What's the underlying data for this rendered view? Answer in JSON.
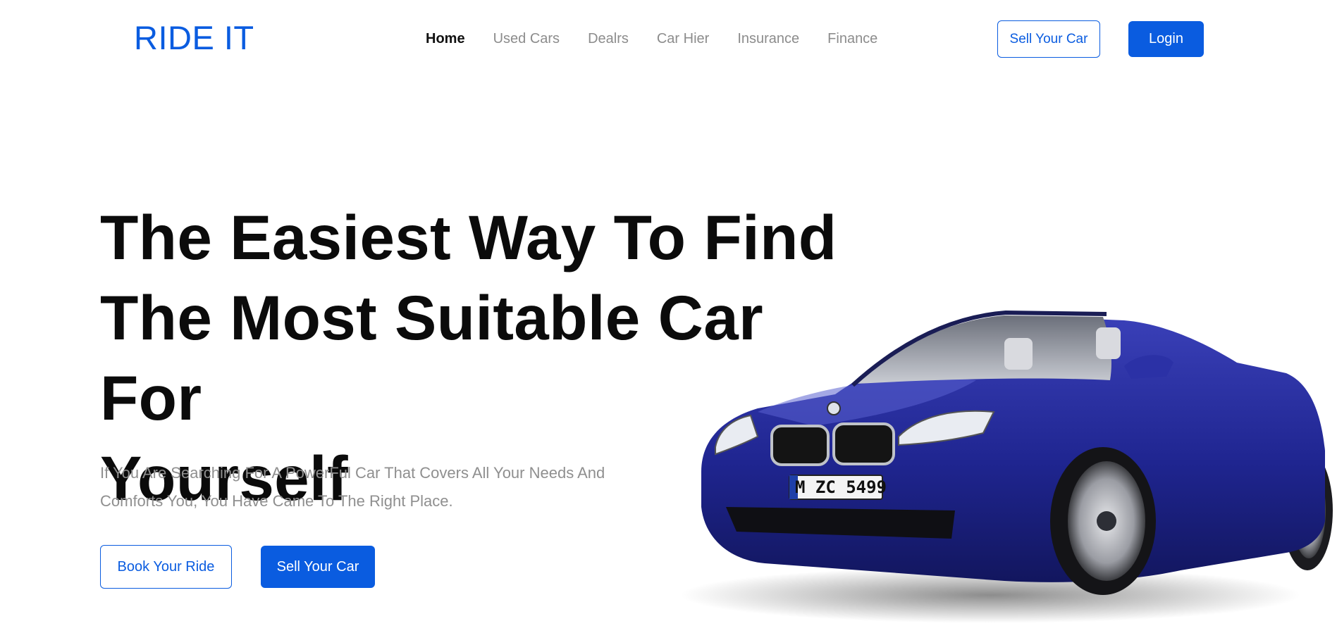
{
  "brand": {
    "logo_text": "RIDE IT",
    "accent_color": "#0a5ce0"
  },
  "nav": {
    "items": [
      {
        "label": "Home",
        "active": true
      },
      {
        "label": "Used Cars",
        "active": false
      },
      {
        "label": "Dealrs",
        "active": false
      },
      {
        "label": "Car Hier",
        "active": false
      },
      {
        "label": "Insurance",
        "active": false
      },
      {
        "label": "Finance",
        "active": false
      }
    ],
    "sell_button": "Sell Your Car",
    "login_button": "Login"
  },
  "hero": {
    "title_line1": "The Easiest Way To Find",
    "title_line2": "The Most Suitable Car For",
    "title_line3": "Yourself",
    "subtitle_line1": "If You Are Searching For A PowerFul Car That Covers All Your Needs And",
    "subtitle_line2": "Comforts You, You Have Came To The Right Place.",
    "book_button": "Book Your Ride",
    "sell_button": "Sell Your Car"
  },
  "car": {
    "license_plate": "M ZC 5499",
    "body_color": "#1f2590"
  }
}
